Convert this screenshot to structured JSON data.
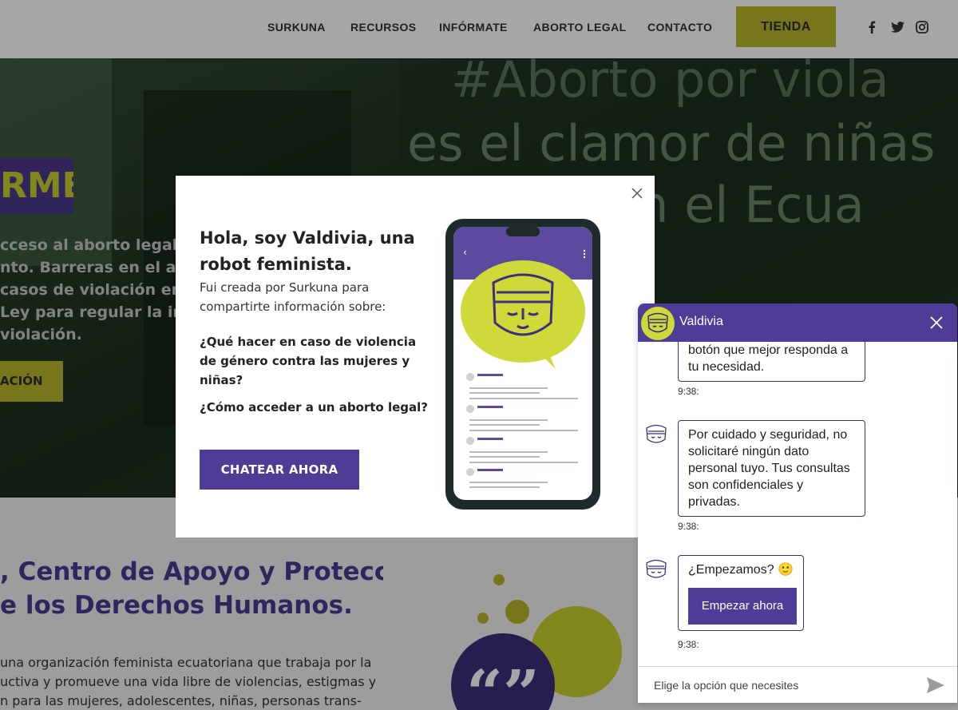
{
  "header": {
    "nav": [
      "SURKUNA",
      "RECURSOS",
      "INFÓRMATE",
      "ABORTO LEGAL",
      "CONTACTO"
    ],
    "shop_label": "TIENDA",
    "social_icons": [
      "facebook-icon",
      "twitter-icon",
      "instagram-icon"
    ]
  },
  "hero": {
    "badge": "RME",
    "text_lines": [
      "cceso al aborto legal c",
      "nto. Barreras en el acc",
      "casos de violación en E",
      "Ley para regular la inte",
      "violación."
    ],
    "button_label": "ACIÓN",
    "wall_text_lines": [
      "#Aborto por viola",
      "es el clamor de niñas",
      "en el Ecua"
    ]
  },
  "lower": {
    "title_lines": [
      ", Centro de Apoyo y Protección",
      "e los Derechos Humanos."
    ],
    "para_lines": [
      "una organización feminista ecuatoriana que trabaja por la",
      "uctiva y promueve una vida libre de violencias, estigmas y",
      "n para las mujeres, adolescentes, niñas, personas trans-"
    ],
    "quote_mark": "“”"
  },
  "modal": {
    "title": "Hola, soy Valdivia, una robot feminista.",
    "subtitle": "Fui creada por Surkuna para compartirte información sobre:",
    "question_1": "¿Qué hacer en caso de violencia de género contra las mujeres y niñas?",
    "question_2": "¿Cómo acceder a un aborto legal?",
    "cta_label": "CHATEAR AHORA"
  },
  "chat": {
    "bot_name": "Valdivia",
    "messages": [
      {
        "text": "botón que mejor responda a tu necesidad.",
        "time": "9:38:"
      },
      {
        "text": "Por cuidado y seguridad, no solicitaré ningún dato personal tuyo. Tus consultas son confidenciales y privadas.",
        "time": "9:38:"
      },
      {
        "text": "¿Empezamos? 🙂",
        "time": "9:38:",
        "button": "Empezar ahora"
      }
    ],
    "input_placeholder": "Elige la opción que necesites"
  },
  "colors": {
    "brand_purple": "#4f3c96",
    "brand_lime": "#b7b62a",
    "bubble_lime": "#cfd93a"
  }
}
